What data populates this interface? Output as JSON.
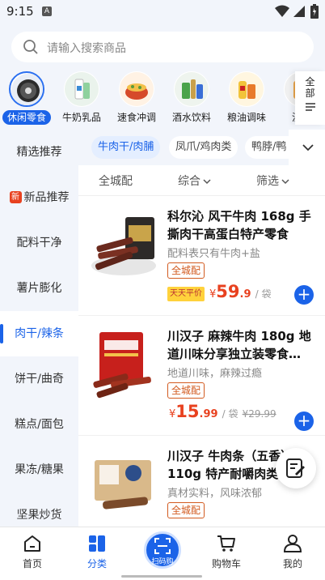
{
  "status_bar": {
    "time": "9:15",
    "notif_badge": "A"
  },
  "search": {
    "placeholder": "请输入搜索商品"
  },
  "categories": [
    {
      "label": "休闲零食",
      "icon": "snack-icon",
      "active": true
    },
    {
      "label": "牛奶乳品",
      "icon": "milk-icon"
    },
    {
      "label": "速食冲调",
      "icon": "instant-food-icon"
    },
    {
      "label": "酒水饮料",
      "icon": "drinks-icon"
    },
    {
      "label": "粮油调味",
      "icon": "grain-oil-icon"
    },
    {
      "label": "沃餐",
      "icon": "meal-icon"
    }
  ],
  "all_categories": {
    "label_line1": "全",
    "label_line2": "部"
  },
  "sidebar": [
    {
      "label": "精选推荐"
    },
    {
      "label": "新品推荐",
      "badge": "新"
    },
    {
      "label": "配料干净"
    },
    {
      "label": "薯片膨化"
    },
    {
      "label": "肉干/辣条",
      "active": true
    },
    {
      "label": "饼干/曲奇"
    },
    {
      "label": "糕点/面包"
    },
    {
      "label": "果冻/糖果"
    },
    {
      "label": "坚果炒货"
    }
  ],
  "subtabs": [
    {
      "label": "牛肉干/肉脯",
      "active": true
    },
    {
      "label": "凤爪/鸡肉类"
    },
    {
      "label": "鸭脖/鸭"
    }
  ],
  "filters": {
    "city": "全城配",
    "sort": "综合",
    "filter": "筛选"
  },
  "products": [
    {
      "name": "科尔沁 风干牛肉 168g 手撕肉干高蛋白特产零食",
      "desc": "配料表只有牛肉+盐",
      "tag": "全城配",
      "daily_badge": "天天平价",
      "currency": "¥",
      "price_int": "59",
      "price_dec": ".9",
      "unit": "/ 袋",
      "orig_price": ""
    },
    {
      "name": "川汉子 麻辣牛肉 180g 地道川味分享独立装零食…",
      "desc": "地道川味，麻辣过瘾",
      "tag": "全城配",
      "currency": "¥",
      "price_int": "15",
      "price_dec": ".99",
      "unit": "/ 袋",
      "orig_price": "¥29.99"
    },
    {
      "name": "川汉子 牛肉条（五香）110g 特产耐嚼肉类",
      "desc": "真材实料，风味浓郁",
      "tag": "全城配"
    }
  ],
  "tabbar": [
    {
      "label": "首页",
      "icon": "home-icon"
    },
    {
      "label": "分类",
      "icon": "category-icon",
      "active": true
    },
    {
      "label": "扫码购",
      "icon": "scan-icon"
    },
    {
      "label": "购物车",
      "icon": "cart-icon"
    },
    {
      "label": "我的",
      "icon": "user-icon"
    }
  ],
  "colors": {
    "accent": "#1b63e8",
    "price": "#e8411f",
    "tag": "#d25a1f",
    "background": "#f2f5fb"
  }
}
